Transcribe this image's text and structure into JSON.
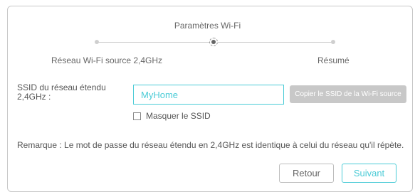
{
  "stepper": {
    "current_title": "Paramètres Wi-Fi",
    "left_label": "Réseau Wi-Fi source 2,4GHz",
    "right_label": "Résumé"
  },
  "form": {
    "ssid_label": "SSID du réseau étendu 2,4GHz :",
    "ssid_value": "MyHome",
    "copy_button_label": "Copier le SSID de la Wi-Fi source",
    "hide_ssid_label": "Masquer le SSID",
    "hide_ssid_checked": false
  },
  "note": "Remarque : Le mot de passe du réseau étendu en 2,4GHz est identique à celui du réseau  qu'il répète.",
  "buttons": {
    "back_label": "Retour",
    "next_label": "Suivant"
  },
  "colors": {
    "accent": "#4acbd6",
    "disabled": "#c8c8c8"
  }
}
